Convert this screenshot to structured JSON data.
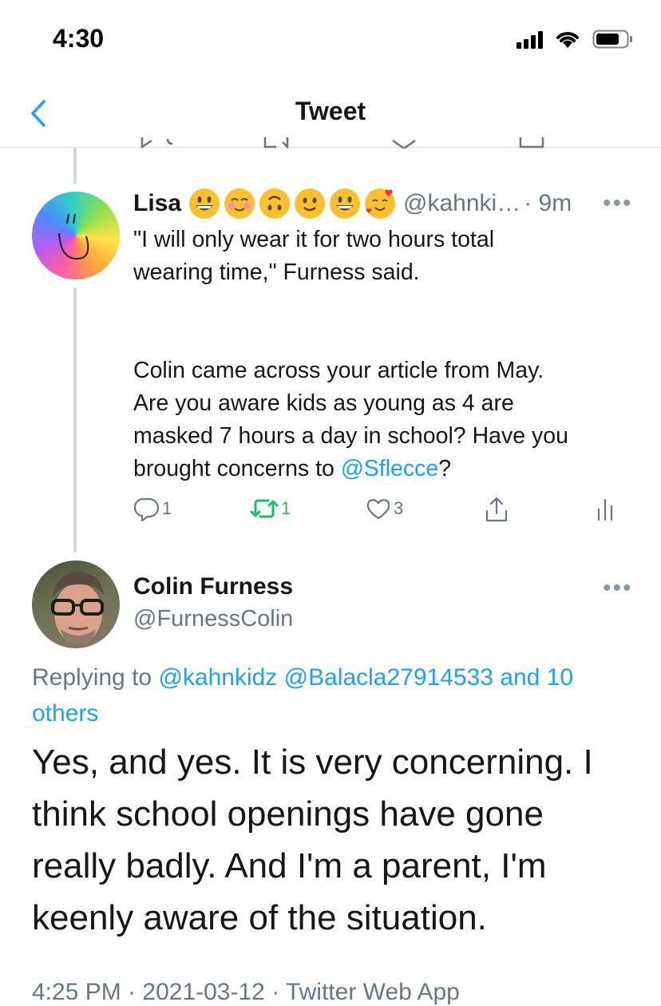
{
  "status_bar": {
    "time": "4:30"
  },
  "nav": {
    "title": "Tweet",
    "back_icon": "chevron-left-icon"
  },
  "reply_tweet": {
    "name": "Lisa",
    "handle": "@kahnki…",
    "time": "· 9m",
    "more": "•••",
    "text_lines": [
      "\"I will only wear it for two hours total",
      "wearing time,\" Furness said.",
      "Colin came across your article from May.",
      "Are you aware kids as young as 4 are",
      "masked 7 hours a day in school? Have you",
      "brought concerns to "
    ],
    "mention": "@Sflecce",
    "text_end": "?",
    "actions": {
      "reply_count": "1",
      "retweet_count": "1",
      "like_count": "3"
    }
  },
  "main_tweet": {
    "name": "Colin Furness",
    "handle": "@FurnessColin",
    "more": "•••",
    "replying_prefix": "Replying to ",
    "replying_links": "@kahnkidz @Balacla27914533 and 10",
    "replying_links_2": "others",
    "text_lines": [
      "Yes, and yes. It is very concerning. I",
      "think school openings have gone",
      "really badly.  And I'm a parent, I'm",
      "keenly aware of the situation."
    ],
    "meta": "4:25 PM · 2021-03-12 · Twitter Web App"
  },
  "colors": {
    "accent": "#1da1f2",
    "retweet_green": "#17bf63",
    "muted": "#657786"
  }
}
